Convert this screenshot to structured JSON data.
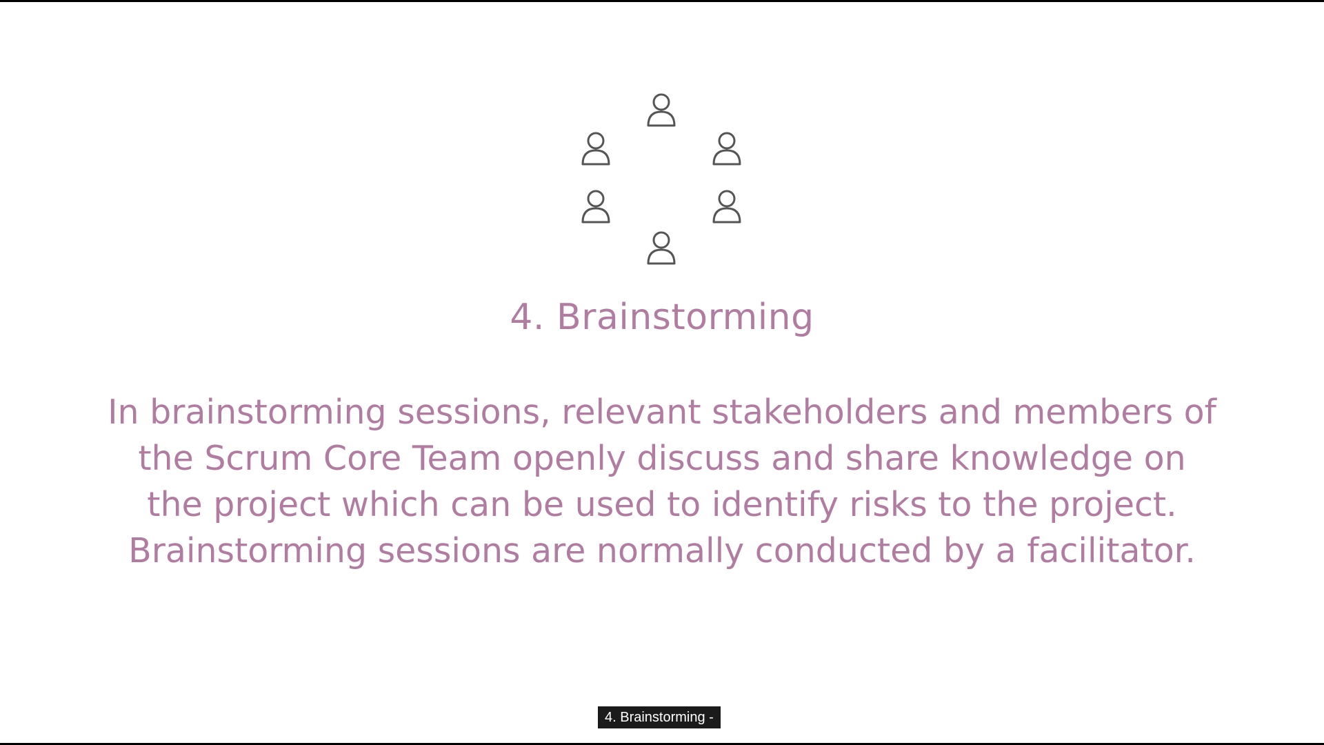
{
  "slide": {
    "icons": [
      "user-icon",
      "user-icon",
      "user-icon",
      "user-icon",
      "user-icon",
      "user-icon"
    ],
    "heading": "4. Brainstorming",
    "body_lines": [
      "In brainstorming sessions, relevant stakeholders and members of",
      "the Scrum Core Team openly discuss and share knowledge on",
      "the project which can be used to identify risks to the project.",
      "Brainstorming sessions are normally conducted by a facilitator."
    ],
    "text_color": "#b07da1",
    "icon_color": "#555555"
  },
  "caption": {
    "text": "4. Brainstorming -"
  }
}
